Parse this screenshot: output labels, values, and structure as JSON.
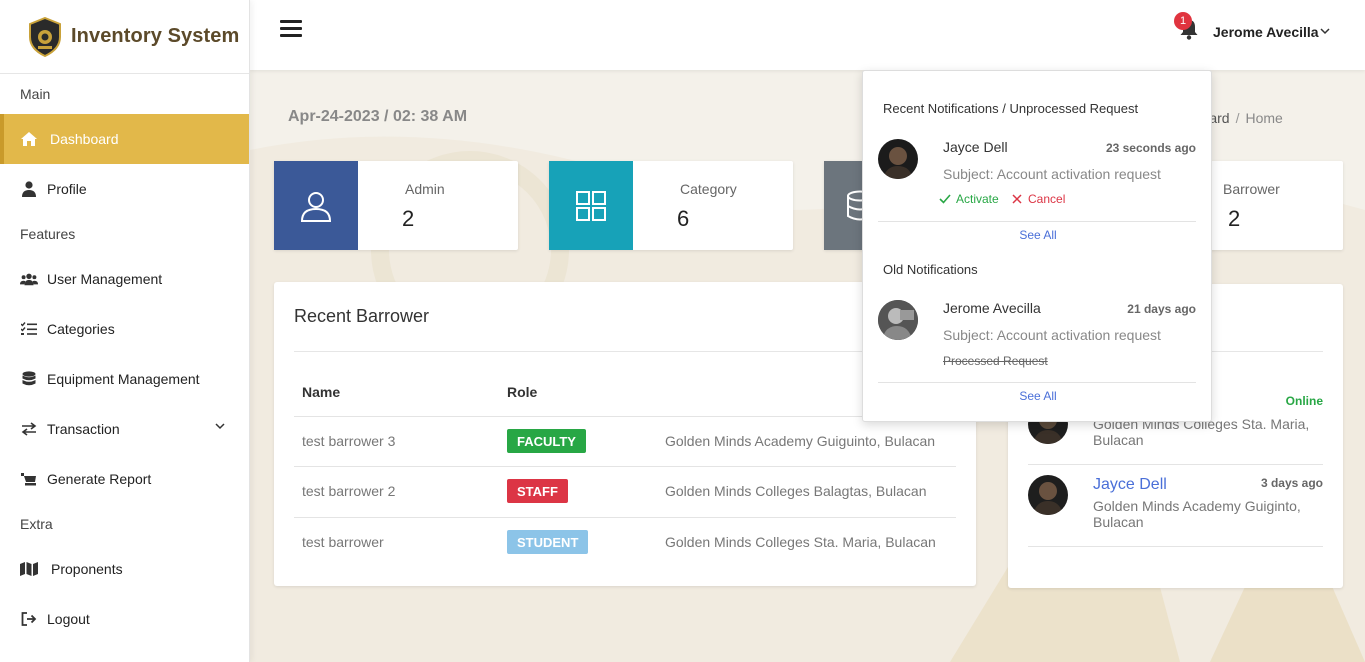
{
  "brand": {
    "title": "Inventory System"
  },
  "sidebar": {
    "sections": [
      "Main",
      "Features",
      "Extra"
    ],
    "items": [
      {
        "label": "Dashboard",
        "icon": "home-icon"
      },
      {
        "label": "Profile",
        "icon": "user-icon"
      },
      {
        "label": "User Management",
        "icon": "users-icon"
      },
      {
        "label": "Categories",
        "icon": "list-check-icon"
      },
      {
        "label": "Equipment Management",
        "icon": "database-icon"
      },
      {
        "label": "Transaction",
        "icon": "exchange-icon"
      },
      {
        "label": "Generate Report",
        "icon": "report-icon"
      },
      {
        "label": "Proponents",
        "icon": "map-icon"
      },
      {
        "label": "Logout",
        "icon": "logout-icon"
      }
    ]
  },
  "header": {
    "notification_count": "1",
    "user_name": "Jerome Avecilla"
  },
  "page": {
    "datetime": "Apr-24-2023 / 02: 38 AM",
    "breadcrumb": [
      "hboard",
      "Home"
    ]
  },
  "stats": [
    {
      "label": "Admin",
      "value": "2",
      "color": "#3b5998",
      "icon": "user-outline-icon"
    },
    {
      "label": "Category",
      "value": "6",
      "color": "#17a2b8",
      "icon": "grid-icon"
    },
    {
      "label": "",
      "value": "",
      "color": "#6c757d",
      "icon": "database-icon"
    },
    {
      "label": "Barrower",
      "value": "2",
      "color": "#ffffff",
      "icon": ""
    }
  ],
  "recent_barrower": {
    "title": "Recent Barrower",
    "columns": [
      "Name",
      "Role"
    ],
    "rows": [
      {
        "name": "test barrower 3",
        "role": "FACULTY",
        "role_color": "#28a745",
        "address": "Golden Minds Academy Guiguinto, Bulacan"
      },
      {
        "name": "test barrower 2",
        "role": "STAFF",
        "role_color": "#dc3545",
        "address": "Golden Minds Colleges Balagtas, Bulacan"
      },
      {
        "name": "test barrower",
        "role": "STUDENT",
        "role_color": "#8cc4e8",
        "address": "Golden Minds Colleges Sta. Maria, Bulacan"
      }
    ]
  },
  "online_card": {
    "entries": [
      {
        "status": "Online",
        "address": "Golden Minds Colleges Sta. Maria, Bulacan"
      },
      {
        "name": "Jayce Dell",
        "time": "3 days ago",
        "address": "Golden Minds Academy Guiginto, Bulacan"
      }
    ]
  },
  "notifications": {
    "recent_heading": "Recent Notifications / Unprocessed Request",
    "old_heading": "Old Notifications",
    "see_all": "See All",
    "recent": {
      "name": "Jayce Dell",
      "time": "23 seconds ago",
      "subject": "Subject: Account activation request",
      "activate": "Activate",
      "cancel": "Cancel"
    },
    "old": {
      "name": "Jerome Avecilla",
      "time": "21 days ago",
      "subject": "Subject: Account activation request",
      "status": "Processed Request"
    }
  }
}
